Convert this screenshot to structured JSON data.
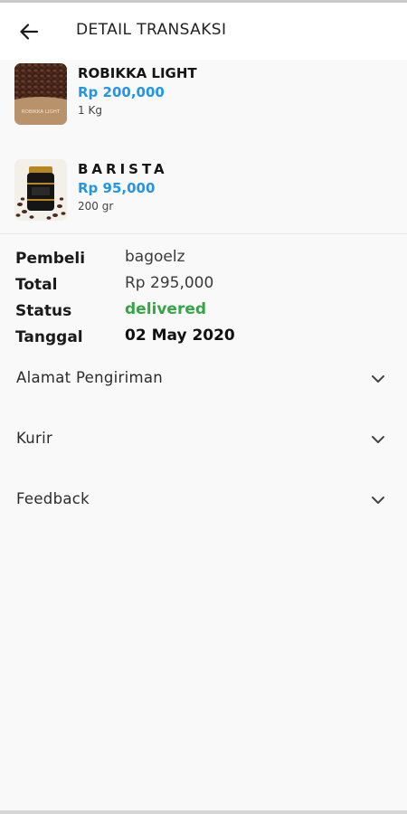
{
  "app_bar": {
    "title": "DETAIL TRANSAKSI",
    "back_icon": "arrow-left-icon"
  },
  "products": [
    {
      "name": "ROBIKKA LIGHT",
      "price": "Rp 200,000",
      "quantity": "1 Kg",
      "image_label": "ROBIKKA LIGHT"
    },
    {
      "name": "BARISTA",
      "price": "Rp 95,000",
      "quantity": "200 gr"
    }
  ],
  "details": {
    "buyer_label": "Pembeli",
    "buyer_value": "bagoelz",
    "total_label": "Total",
    "total_value": "Rp 295,000",
    "status_label": "Status",
    "status_value": "delivered",
    "date_label": "Tanggal",
    "date_value": "02 May 2020"
  },
  "sections": [
    {
      "label": "Alamat Pengiriman",
      "icon": "chevron-down-icon"
    },
    {
      "label": "Kurir",
      "icon": "chevron-down-icon"
    },
    {
      "label": "Feedback",
      "icon": "chevron-down-icon"
    }
  ],
  "colors": {
    "price": "#2196e8",
    "status_delivered": "#33a744",
    "background": "#f9f9f9",
    "app_bar": "#ffffff"
  }
}
